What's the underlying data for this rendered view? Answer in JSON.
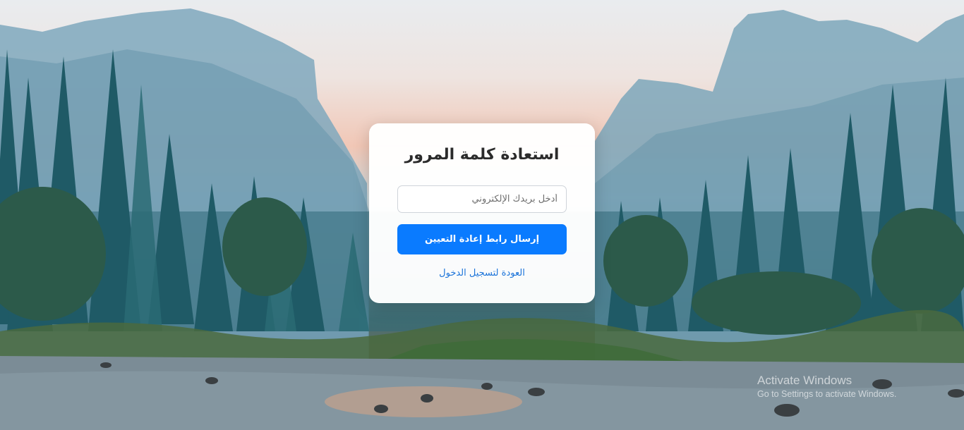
{
  "form": {
    "title": "استعادة كلمة المرور",
    "email_placeholder": "أدخل بريدك الإلكتروني",
    "email_value": "",
    "submit_label": "إرسال رابط إعادة التعيين",
    "back_link": "العودة لتسجيل الدخول"
  },
  "watermark": {
    "title": "Activate Windows",
    "subtitle": "Go to Settings to activate Windows."
  },
  "colors": {
    "primary_button": "#0a7bff",
    "link": "#1a73d9",
    "card_background": "#ffffff"
  }
}
